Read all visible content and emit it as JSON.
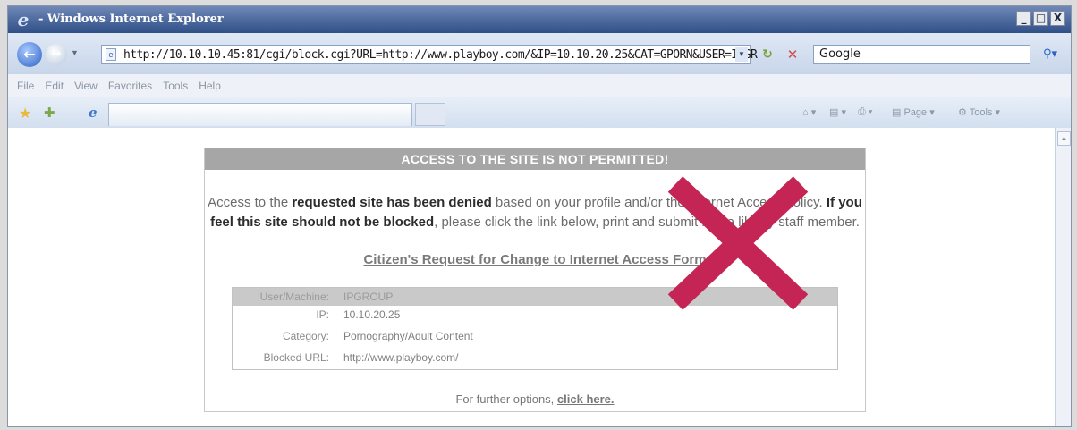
{
  "window": {
    "title": "- Windows Internet Explorer",
    "controls": [
      "_",
      "□",
      "X"
    ]
  },
  "addressbar": {
    "url": "http://10.10.10.45:81/cgi/block.cgi?URL=http://www.playboy.com/&IP=10.10.20.25&CAT=GPORN&USER=IPGR",
    "search_value": "Google",
    "icons": [
      "back-icon",
      "forward-icon",
      "refresh-icon",
      "stop-icon",
      "search-icon"
    ]
  },
  "menubar": {
    "items": [
      "File",
      "Edit",
      "View",
      "Favorites",
      "Tools",
      "Help"
    ]
  },
  "commandbar": {
    "page_label": "Page",
    "tools_label": "Tools"
  },
  "block_page": {
    "header": "ACCESS TO THE SITE IS NOT PERMITTED!",
    "msg_1": "Access to the ",
    "msg_2": "requested site has been denied",
    "msg_3": " based on your profile and/or the Internet Access Policy. ",
    "msg_4": "If you feel this site should not be blocked",
    "msg_5": ", please click the link below, print and submit it to a library staff member.",
    "request_link": "Citizen's Request for Change to Internet Access Form",
    "info": [
      {
        "label": "User/Machine:",
        "value": "IPGROUP"
      },
      {
        "label": "IP:",
        "value": "10.10.20.25"
      },
      {
        "label": "Category:",
        "value": "Pornography/Adult Content"
      },
      {
        "label": "Blocked URL:",
        "value": "http://www.playboy.com/"
      }
    ],
    "further_text": "For further options, ",
    "further_link": "click here."
  },
  "colors": {
    "titlebar": "#2f4f87",
    "block_header": "#a6a6a6",
    "red_x": "#c42554"
  }
}
